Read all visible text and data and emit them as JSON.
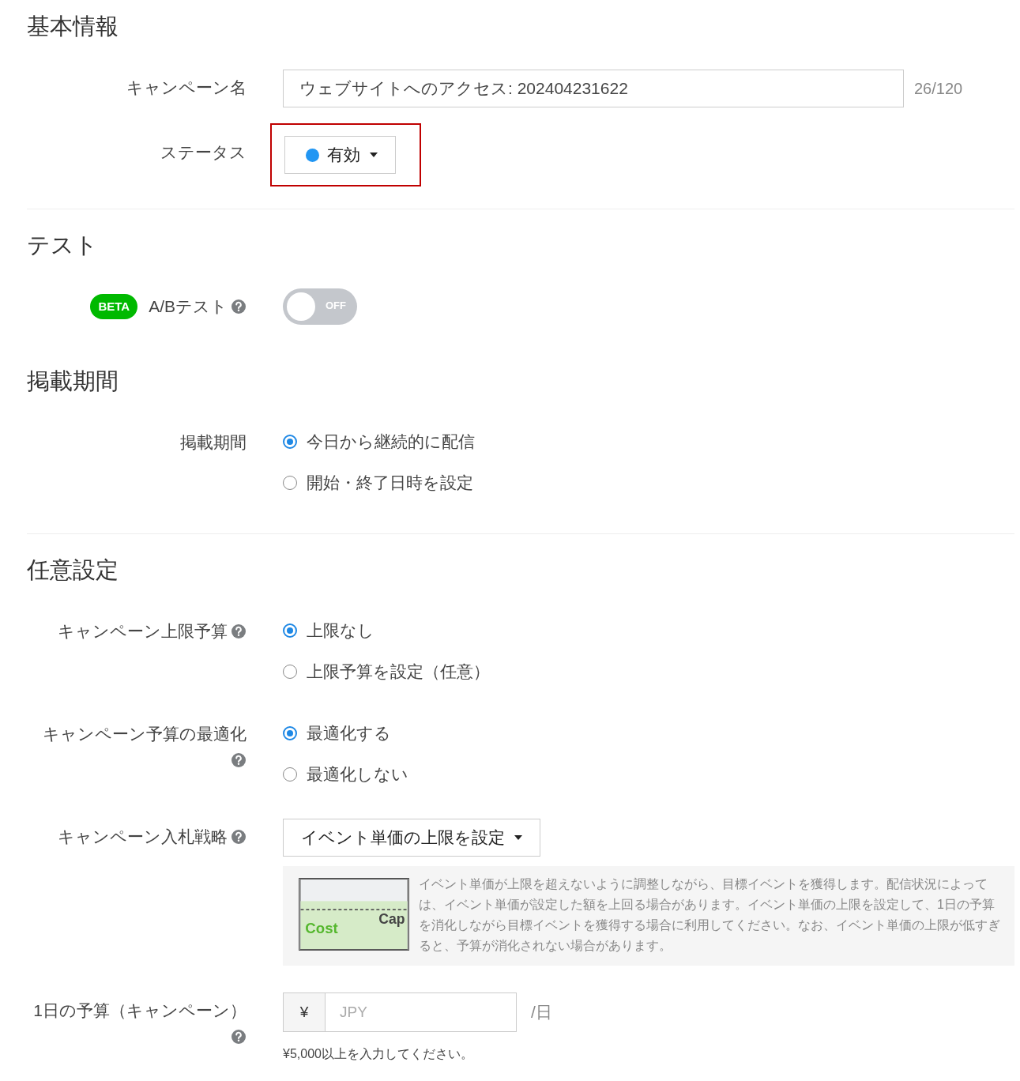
{
  "sections": [
    {
      "title": "基本情報",
      "divider_after": true,
      "rows": [
        {
          "kind": "text",
          "label": "キャンペーン名",
          "help": false,
          "value": "ウェブサイトへのアクセス: 202404231622",
          "counter": "26/120"
        },
        {
          "kind": "dropdown",
          "label": "ステータス",
          "help": false,
          "value": "有効",
          "color": "#2196f3",
          "highlighted": true
        }
      ]
    },
    {
      "title": "テスト",
      "divider_after": false,
      "rows": [
        {
          "kind": "toggle",
          "label": "A/Bテスト",
          "help": true,
          "badge": "BETA",
          "on": false,
          "state_text": "OFF"
        }
      ]
    },
    {
      "title": "掲載期間",
      "divider_after": true,
      "rows": [
        {
          "kind": "radio",
          "label": "掲載期間",
          "help": false,
          "options": [
            {
              "label": "今日から継続的に配信",
              "selected": true
            },
            {
              "label": "開始・終了日時を設定",
              "selected": false
            }
          ]
        }
      ]
    },
    {
      "title": "任意設定",
      "divider_after": false,
      "rows": [
        {
          "kind": "radio",
          "label": "キャンペーン上限予算",
          "help": true,
          "options": [
            {
              "label": "上限なし",
              "selected": true
            },
            {
              "label": "上限予算を設定（任意）",
              "selected": false
            }
          ]
        },
        {
          "kind": "radio",
          "label": "キャンペーン予算の最適化",
          "help": true,
          "options": [
            {
              "label": "最適化する",
              "selected": true
            },
            {
              "label": "最適化しない",
              "selected": false
            }
          ]
        },
        {
          "kind": "strategy",
          "label": "キャンペーン入札戦略",
          "help": true,
          "value": "イベント単価の上限を設定",
          "diagram": {
            "cost": "Cost",
            "cap": "Cap"
          },
          "info": "イベント単価が上限を超えないように調整しながら、目標イベントを獲得します。配信状況によっては、イベント単価が設定した額を上回る場合があります。イベント単価の上限を設定して、1日の予算を消化しながら目標イベントを獲得する場合に利用してください。なお、イベント単価の上限が低すぎると、予算が消化されない場合があります。"
        },
        {
          "kind": "currency",
          "label": "1日の予算（キャンペーン）",
          "help": true,
          "prefix": "¥",
          "placeholder": "JPY",
          "suffix": "/日",
          "hint": "¥5,000以上を入力してください。"
        }
      ]
    }
  ]
}
